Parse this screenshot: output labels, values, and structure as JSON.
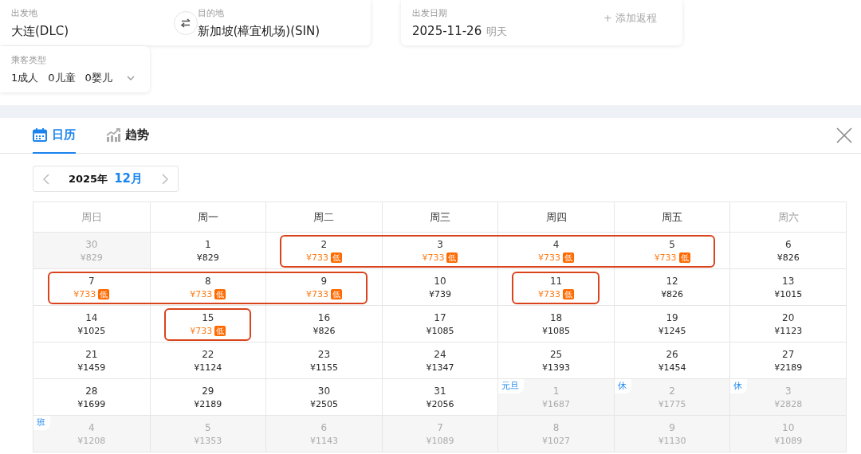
{
  "search": {
    "origin": {
      "label": "出发地",
      "value": "大连(DLC)"
    },
    "destination": {
      "label": "目的地",
      "value": "新加坡(樟宜机场)(SIN)"
    },
    "date": {
      "label": "出发日期",
      "value": "2025-11-26",
      "note": "明天",
      "return_link": "+ 添加返程"
    },
    "passengers": {
      "label": "乘客类型",
      "adults": "1成人",
      "children": "0儿童",
      "infants": "0婴儿"
    }
  },
  "tabs": [
    {
      "label": "日历",
      "selected": true,
      "kind": "calendar"
    },
    {
      "label": "趋势",
      "selected": false,
      "kind": "trend"
    }
  ],
  "month_nav": {
    "year": "2025年",
    "month": "12月"
  },
  "weekdays": [
    {
      "label": "周日",
      "weekend": true
    },
    {
      "label": "周一",
      "weekend": false
    },
    {
      "label": "周二",
      "weekend": false
    },
    {
      "label": "周三",
      "weekend": false
    },
    {
      "label": "周四",
      "weekend": false
    },
    {
      "label": "周五",
      "weekend": false
    },
    {
      "label": "周六",
      "weekend": true
    }
  ],
  "weeks": [
    [
      {
        "day": "30",
        "price": "¥829",
        "dim": true,
        "lowest": false,
        "circled": false
      },
      {
        "day": "1",
        "price": "¥829",
        "dim": false,
        "lowest": false,
        "circled": false
      },
      {
        "day": "2",
        "price": "¥733",
        "dim": false,
        "lowest": true,
        "low_label": "低",
        "circled": true
      },
      {
        "day": "3",
        "price": "¥733",
        "dim": false,
        "lowest": true,
        "low_label": "低",
        "circled": true
      },
      {
        "day": "4",
        "price": "¥733",
        "dim": false,
        "lowest": true,
        "low_label": "低",
        "circled": true
      },
      {
        "day": "5",
        "price": "¥733",
        "dim": false,
        "lowest": true,
        "low_label": "低",
        "circled": true
      },
      {
        "day": "6",
        "price": "¥826",
        "dim": false,
        "lowest": false,
        "circled": false
      }
    ],
    [
      {
        "day": "7",
        "price": "¥733",
        "dim": false,
        "lowest": true,
        "low_label": "低",
        "circled": true
      },
      {
        "day": "8",
        "price": "¥733",
        "dim": false,
        "lowest": true,
        "low_label": "低",
        "circled": true
      },
      {
        "day": "9",
        "price": "¥733",
        "dim": false,
        "lowest": true,
        "low_label": "低",
        "circled": true
      },
      {
        "day": "10",
        "price": "¥739",
        "dim": false,
        "lowest": false,
        "circled": false
      },
      {
        "day": "11",
        "price": "¥733",
        "dim": false,
        "lowest": true,
        "low_label": "低",
        "circled": true
      },
      {
        "day": "12",
        "price": "¥826",
        "dim": false,
        "lowest": false,
        "circled": false
      },
      {
        "day": "13",
        "price": "¥1015",
        "dim": false,
        "lowest": false,
        "circled": false
      }
    ],
    [
      {
        "day": "14",
        "price": "¥1025",
        "dim": false,
        "lowest": false,
        "circled": false
      },
      {
        "day": "15",
        "price": "¥733",
        "dim": false,
        "lowest": true,
        "low_label": "低",
        "circled": true
      },
      {
        "day": "16",
        "price": "¥826",
        "dim": false,
        "lowest": false,
        "circled": false
      },
      {
        "day": "17",
        "price": "¥1085",
        "dim": false,
        "lowest": false,
        "circled": false
      },
      {
        "day": "18",
        "price": "¥1085",
        "dim": false,
        "lowest": false,
        "circled": false
      },
      {
        "day": "19",
        "price": "¥1245",
        "dim": false,
        "lowest": false,
        "circled": false
      },
      {
        "day": "20",
        "price": "¥1123",
        "dim": false,
        "lowest": false,
        "circled": false
      }
    ],
    [
      {
        "day": "21",
        "price": "¥1459",
        "dim": false,
        "lowest": false,
        "circled": false
      },
      {
        "day": "22",
        "price": "¥1124",
        "dim": false,
        "lowest": false,
        "circled": false
      },
      {
        "day": "23",
        "price": "¥1155",
        "dim": false,
        "lowest": false,
        "circled": false
      },
      {
        "day": "24",
        "price": "¥1347",
        "dim": false,
        "lowest": false,
        "circled": false
      },
      {
        "day": "25",
        "price": "¥1393",
        "dim": false,
        "lowest": false,
        "circled": false
      },
      {
        "day": "26",
        "price": "¥1454",
        "dim": false,
        "lowest": false,
        "circled": false
      },
      {
        "day": "27",
        "price": "¥2189",
        "dim": false,
        "lowest": false,
        "circled": false
      }
    ],
    [
      {
        "day": "28",
        "price": "¥1699",
        "dim": false,
        "lowest": false,
        "circled": false
      },
      {
        "day": "29",
        "price": "¥2189",
        "dim": false,
        "lowest": false,
        "circled": false
      },
      {
        "day": "30",
        "price": "¥2505",
        "dim": false,
        "lowest": false,
        "circled": false
      },
      {
        "day": "31",
        "price": "¥2056",
        "dim": false,
        "lowest": false,
        "circled": false
      },
      {
        "day": "1",
        "price": "¥1687",
        "dim": true,
        "lowest": false,
        "tag": "元旦",
        "circled": false
      },
      {
        "day": "2",
        "price": "¥1775",
        "dim": true,
        "lowest": false,
        "tag": "休",
        "circled": false
      },
      {
        "day": "3",
        "price": "¥2828",
        "dim": true,
        "lowest": false,
        "tag": "休",
        "circled": false
      }
    ],
    [
      {
        "day": "4",
        "price": "¥1208",
        "dim": true,
        "lowest": false,
        "tag": "班",
        "circled": false
      },
      {
        "day": "5",
        "price": "¥1353",
        "dim": true,
        "lowest": false,
        "circled": false
      },
      {
        "day": "6",
        "price": "¥1143",
        "dim": true,
        "lowest": false,
        "circled": false
      },
      {
        "day": "7",
        "price": "¥1089",
        "dim": true,
        "lowest": false,
        "circled": false
      },
      {
        "day": "8",
        "price": "¥1027",
        "dim": true,
        "lowest": false,
        "circled": false
      },
      {
        "day": "9",
        "price": "¥1130",
        "dim": true,
        "lowest": false,
        "circled": false
      },
      {
        "day": "10",
        "price": "¥1089",
        "dim": true,
        "lowest": false,
        "circled": false
      }
    ]
  ]
}
